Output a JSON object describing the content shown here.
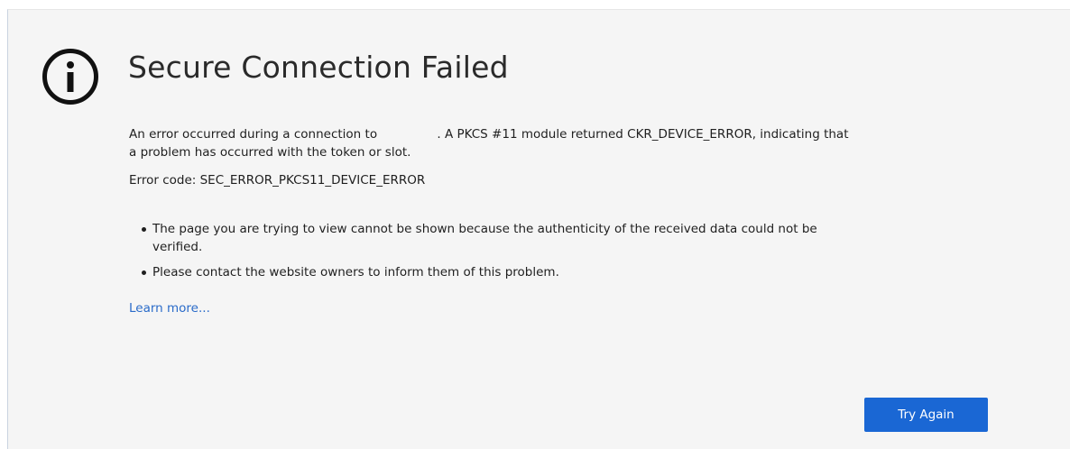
{
  "page": {
    "icon": "info-circle-icon",
    "title": "Secure Connection Failed",
    "description_line1_pre": "An error occurred during a connection to",
    "description_line1_post": ". A PKCS #11 module returned CKR_DEVICE_ERROR, indicating that",
    "description_line2": "a problem has occurred with the token or slot.",
    "error_code": "Error code: SEC_ERROR_PKCS11_DEVICE_ERROR",
    "bullets": [
      {
        "line1": "The page you are trying to view cannot be shown because the authenticity of the received data could not be",
        "line2": "verified."
      },
      {
        "line1": "Please contact the website owners to inform them of this problem."
      }
    ],
    "learn_more": "Learn more...",
    "try_again": "Try Again"
  },
  "colors": {
    "background": "#f5f5f5",
    "link": "#2a6bc9",
    "button": "#1a67d4",
    "button_text": "#ffffff"
  }
}
